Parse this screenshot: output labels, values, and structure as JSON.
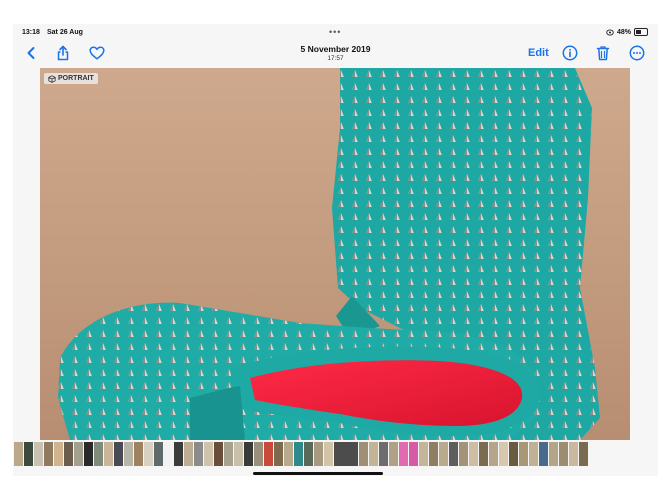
{
  "status_bar": {
    "time": "13:18",
    "date": "Sat 26 Aug",
    "battery": "48%"
  },
  "nav": {
    "title": "5 November 2019",
    "subtitle": "17:57",
    "edit_label": "Edit"
  },
  "icons": {
    "back": "chevron-left-icon",
    "share": "share-icon",
    "favorite": "heart-icon",
    "info": "info-icon",
    "delete": "trash-icon",
    "more": "more-icon"
  },
  "photo": {
    "badge_label": "PORTRAIT"
  },
  "filmstrip": {
    "thumb_colors": [
      "#b9a98a",
      "#3d4b3f",
      "#c7c2b1",
      "#8f7a5f",
      "#d0b490",
      "#6a5d4e",
      "#a3a08f",
      "#2a2a2a",
      "#7e8a7a",
      "#c9b59a",
      "#4a4a55",
      "#b7b5a8",
      "#9d8161",
      "#d8d0c0",
      "#5d6b6a",
      "#f2f2f2",
      "#3b3b3b",
      "#bcae93",
      "#8b8b8b",
      "#cfc3ad",
      "#6b4d3b",
      "#a7a18f",
      "#c8c0aa",
      "#3a3a3a",
      "#9a8f7a",
      "#c84a3a",
      "#7e6a4f",
      "#b8a88c",
      "#2e8a8a",
      "#5a6a5a",
      "#a89a80",
      "#d2c4a8",
      "#4c4c4c",
      "#9e8f76",
      "#c2b497",
      "#6c6c6c",
      "#b0a086",
      "#e26ab0",
      "#d95aa4",
      "#c4b49a",
      "#8e7e64",
      "#b9aa8e",
      "#5e5e5e",
      "#a39379",
      "#cdbda2",
      "#7b6b51",
      "#b5a68b",
      "#d6c8ac",
      "#6a5a40",
      "#a89878",
      "#c0b094",
      "#4a6a8a",
      "#b4a488",
      "#9c8c72",
      "#cab99e",
      "#7a6a50"
    ]
  }
}
